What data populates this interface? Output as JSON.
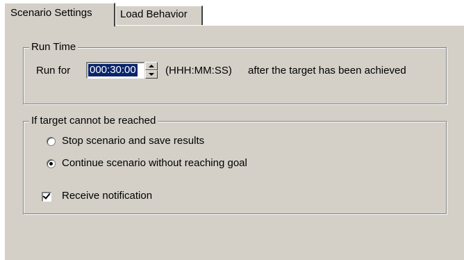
{
  "tabs": {
    "scenario_settings": "Scenario Settings",
    "load_behavior": "Load Behavior"
  },
  "run_time": {
    "group_title": "Run Time",
    "run_for_label": "Run for",
    "duration_value": "000:30:00",
    "format_hint": "(HHH:MM:SS)",
    "after_text": "after the target has been achieved"
  },
  "target_unreachable": {
    "group_title": "If target cannot be reached",
    "options": [
      {
        "label": "Stop scenario and save results",
        "selected": false
      },
      {
        "label": "Continue scenario without reaching goal",
        "selected": true
      }
    ],
    "notification_label": "Receive notification",
    "notification_checked": true
  },
  "icons": {
    "spin_up": "arrow-up-icon",
    "spin_down": "arrow-down-icon",
    "check": "checkmark-icon"
  },
  "colors": {
    "face": "#d4d0c8",
    "selection": "#0a246a",
    "window": "#ffffff"
  }
}
